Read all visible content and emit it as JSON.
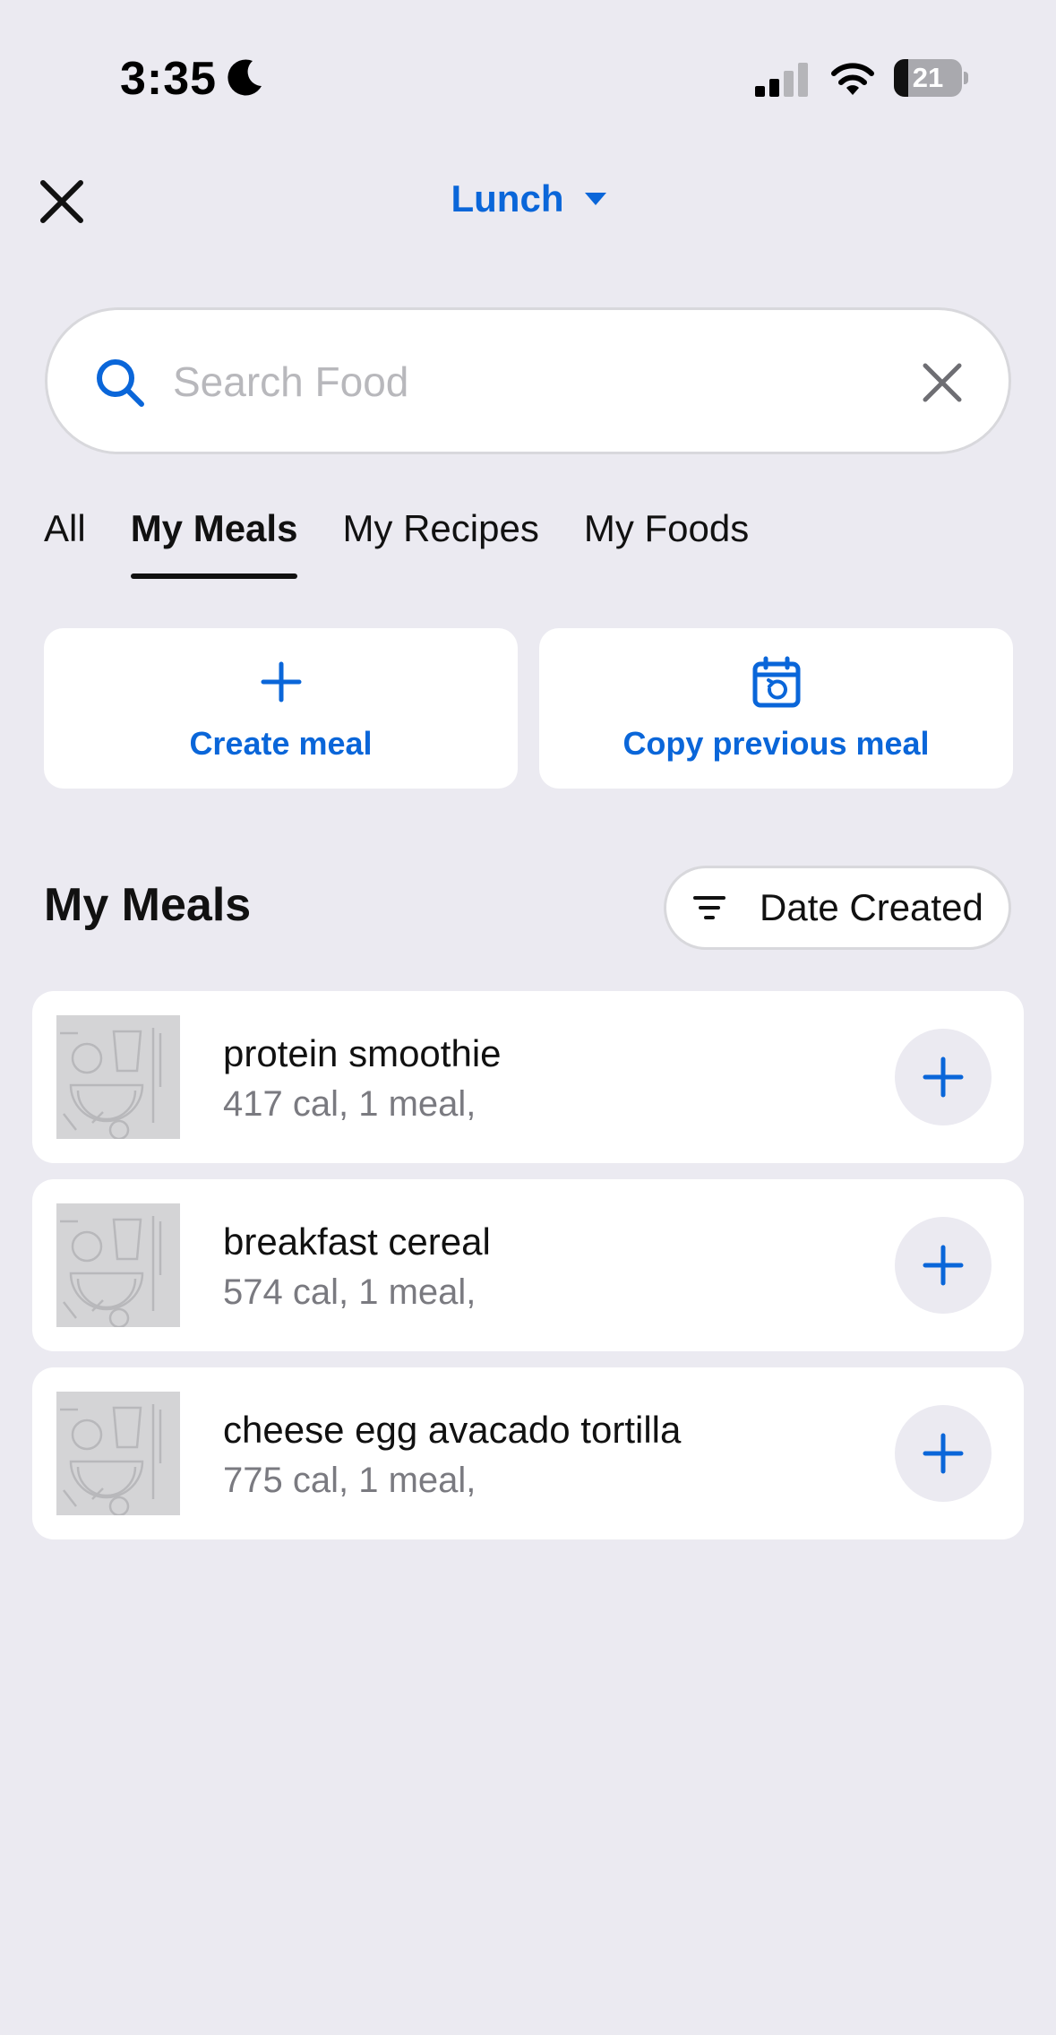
{
  "status_bar": {
    "time": "3:35",
    "battery_level": "21",
    "icons": [
      "moon-icon",
      "cellular-signal-icon",
      "wifi-icon",
      "battery-icon"
    ]
  },
  "header": {
    "meal_title": "Lunch",
    "close_icon": "close-icon",
    "caret_icon": "caret-down-icon"
  },
  "search": {
    "placeholder": "Search Food",
    "value": "",
    "search_icon": "search-icon",
    "clear_icon": "clear-icon"
  },
  "tabs": [
    {
      "label": "All",
      "active": false
    },
    {
      "label": "My Meals",
      "active": true
    },
    {
      "label": "My Recipes",
      "active": false
    },
    {
      "label": "My Foods",
      "active": false
    }
  ],
  "actions": {
    "create_meal": {
      "label": "Create meal",
      "icon": "plus-icon"
    },
    "copy_previous": {
      "label": "Copy previous meal",
      "icon": "calendar-history-icon"
    }
  },
  "section": {
    "title": "My Meals",
    "sort_label": "Date Created",
    "sort_icon": "filter-icon"
  },
  "meals": [
    {
      "name": "protein smoothie",
      "subtitle": "417 cal, 1 meal,"
    },
    {
      "name": "breakfast cereal",
      "subtitle": "574 cal, 1 meal,"
    },
    {
      "name": "cheese egg avacado tortilla",
      "subtitle": "775 cal, 1 meal,"
    }
  ],
  "colors": {
    "accent": "#0a66d9",
    "background": "#ebeaf1",
    "card": "#ffffff",
    "secondary_text": "#7a7a80"
  }
}
